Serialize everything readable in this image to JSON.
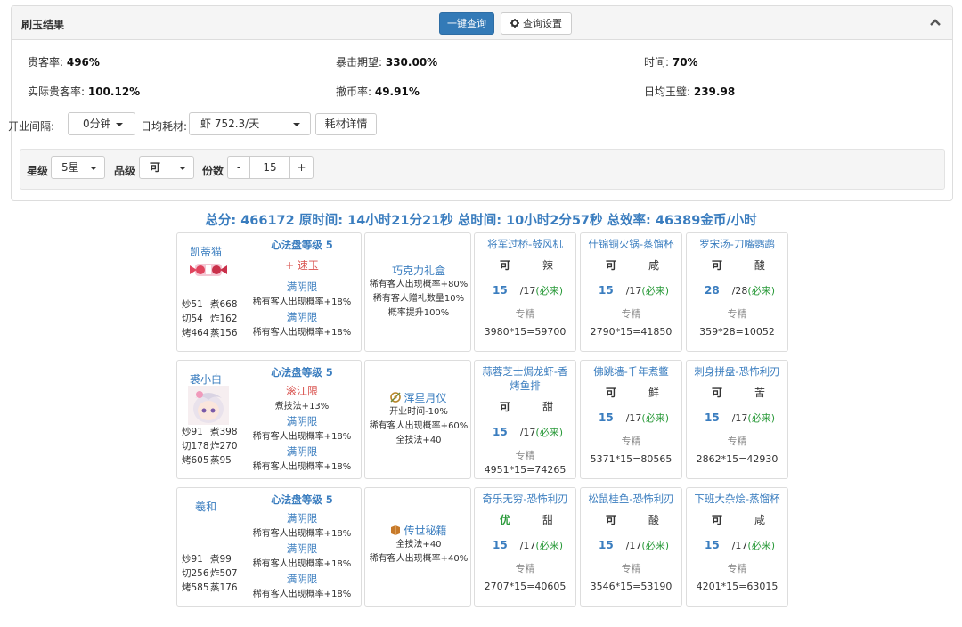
{
  "panel": {
    "title": "刷玉结果",
    "query_button": "一键查询",
    "settings_button": "查询设置",
    "settings_icon": "gear-icon",
    "collapse_icon": "chevron-up-icon"
  },
  "stats": [
    {
      "label": "贵客率: ",
      "value": "496%"
    },
    {
      "label": "暴击期望: ",
      "value": "330.00%"
    },
    {
      "label": "时间: ",
      "value": "70%"
    },
    {
      "label": "实际贵客率: ",
      "value": "100.12%"
    },
    {
      "label": "撤币率: ",
      "value": "49.91%"
    },
    {
      "label": "日均玉璧: ",
      "value": "239.98"
    }
  ],
  "controls": {
    "interval_label": "开业间隔:",
    "interval_value": "0分钟",
    "consume_label": "日均耗材:",
    "consume_value": "虾 752.3/天",
    "consume_detail_button": "耗材详情",
    "star_label": "星级",
    "star_value": "5星",
    "grade_label": "品级",
    "grade_value": "可",
    "portion_label": "份数",
    "portion_minus": "-",
    "portion_value": "15",
    "portion_plus": "+"
  },
  "summary": "总分: 466172 原时间: 14小时21分21秒 总时间: 10小时2分57秒 总效率: 46389金币/小时",
  "chefs": [
    {
      "name": "凯蒂猫",
      "stats": [
        "炒51",
        "煮668",
        "切54",
        "炸162",
        "烤464",
        "蒸156"
      ],
      "skill_title": "心法盘等级 5",
      "skill_lines": [
        {
          "text": "+ 速玉",
          "cls": "red"
        },
        {
          "text": "",
          "cls": ""
        },
        {
          "text": "满阴限",
          "cls": "blue"
        },
        {
          "text": "稀有客人出现概率+18%",
          "cls": ""
        },
        {
          "text": "满阴限",
          "cls": "blue"
        },
        {
          "text": "稀有客人出现概率+18%",
          "cls": ""
        }
      ],
      "equip_name": "巧克力礼盒",
      "equip_lines": [
        "稀有客人出现概率+80%",
        "稀有客人赠礼数量10%",
        "概率提升100%"
      ],
      "dishes": [
        {
          "name": "将军过桥-鼓风机",
          "grade": "可",
          "taste": "辣",
          "qty": "15",
          "max": "/17",
          "must": "(必来)",
          "spec": "专精",
          "formula": "3980*15=59700"
        },
        {
          "name": "什锦铜火锅-蒸馏杯",
          "grade": "可",
          "taste": "咸",
          "qty": "15",
          "max": "/17",
          "must": "(必来)",
          "spec": "专精",
          "formula": "2790*15=41850"
        },
        {
          "name": "罗宋汤-刀嘴鹦鹉",
          "grade": "可",
          "taste": "酸",
          "qty": "28",
          "max": "/28",
          "must": "(必来)",
          "spec": "专精",
          "formula": "359*28=10052"
        }
      ]
    },
    {
      "name": "裘小白",
      "stats": [
        "炒91",
        "煮398",
        "切178",
        "炸270",
        "烤605",
        "蒸95"
      ],
      "skill_title": "心法盘等级 5",
      "skill_lines": [
        {
          "text": "滚江限",
          "cls": "red"
        },
        {
          "text": "煮技法+13%",
          "cls": ""
        },
        {
          "text": "满阴限",
          "cls": "blue"
        },
        {
          "text": "稀有客人出现概率+18%",
          "cls": ""
        },
        {
          "text": "满阴限",
          "cls": "blue"
        },
        {
          "text": "稀有客人出现概率+18%",
          "cls": ""
        }
      ],
      "equip_name": "浑星月仪",
      "equip_lines": [
        "开业时间-10%",
        "稀有客人出现概率+60%",
        "全技法+40"
      ],
      "dishes": [
        {
          "name": "蒜蓉芝士焗龙虾-香烤鱼排",
          "grade": "可",
          "taste": "甜",
          "qty": "15",
          "max": "/17",
          "must": "(必来)",
          "spec": "专精",
          "formula": "4951*15=74265"
        },
        {
          "name": "佛跳墙-千年煮鳖",
          "grade": "可",
          "taste": "鲜",
          "qty": "15",
          "max": "/17",
          "must": "(必来)",
          "spec": "专精",
          "formula": "5371*15=80565"
        },
        {
          "name": "刺身拼盘-恐怖利刃",
          "grade": "可",
          "taste": "苦",
          "qty": "15",
          "max": "/17",
          "must": "(必来)",
          "spec": "专精",
          "formula": "2862*15=42930"
        }
      ]
    },
    {
      "name": "羲和",
      "stats": [
        "炒91",
        "煮99",
        "切256",
        "炸507",
        "烤585",
        "蒸176"
      ],
      "skill_title": "心法盘等级 5",
      "skill_lines": [
        {
          "text": "满阴限",
          "cls": "blue"
        },
        {
          "text": "稀有客人出现概率+18%",
          "cls": ""
        },
        {
          "text": "满阴限",
          "cls": "blue"
        },
        {
          "text": "稀有客人出现概率+18%",
          "cls": ""
        },
        {
          "text": "满阴限",
          "cls": "blue"
        },
        {
          "text": "稀有客人出现概率+18%",
          "cls": ""
        }
      ],
      "equip_name": "传世秘籍",
      "equip_lines": [
        "全技法+40",
        "稀有客人出现概率+40%"
      ],
      "dishes": [
        {
          "name": "奇乐无穷-恐怖利刃",
          "grade": "优",
          "taste": "甜",
          "qty": "15",
          "max": "/17",
          "must": "(必来)",
          "spec": "专精",
          "formula": "2707*15=40605"
        },
        {
          "name": "松鼠桂鱼-恐怖利刃",
          "grade": "可",
          "taste": "酸",
          "qty": "15",
          "max": "/17",
          "must": "(必来)",
          "spec": "专精",
          "formula": "3546*15=53190"
        },
        {
          "name": "下班大杂烩-蒸馏杯",
          "grade": "可",
          "taste": "咸",
          "qty": "15",
          "max": "/17",
          "must": "(必来)",
          "spec": "专精",
          "formula": "4201*15=63015"
        }
      ]
    }
  ]
}
